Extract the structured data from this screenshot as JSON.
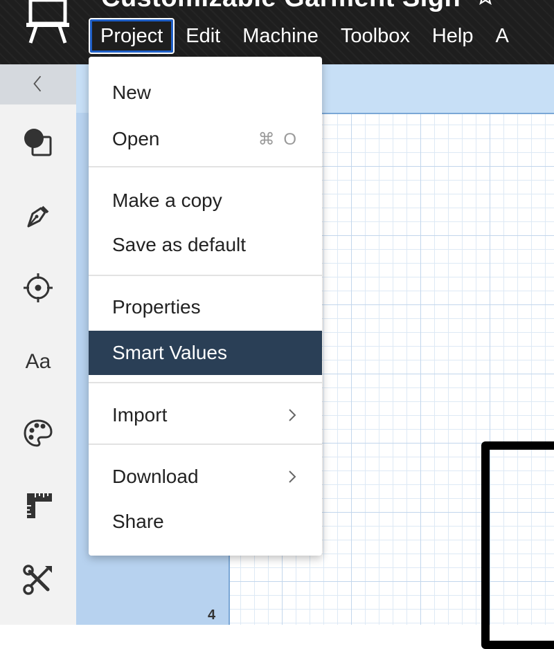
{
  "header": {
    "title": "Customizable Garment Sign",
    "menus": [
      {
        "label": "Project",
        "active": true
      },
      {
        "label": "Edit"
      },
      {
        "label": "Machine"
      },
      {
        "label": "Toolbox"
      },
      {
        "label": "Help"
      },
      {
        "label": "A"
      }
    ]
  },
  "sidebar": {
    "collapse_glyph": "<",
    "tools": [
      {
        "name": "shapes-icon"
      },
      {
        "name": "pen-icon"
      },
      {
        "name": "crosshair-icon"
      },
      {
        "name": "text-icon",
        "label": "Aa"
      },
      {
        "name": "palette-icon"
      },
      {
        "name": "ruler-icon"
      },
      {
        "name": "tools-icon"
      }
    ]
  },
  "dropdown": {
    "items": [
      {
        "label": "New",
        "shortcut": ""
      },
      {
        "label": "Open",
        "shortcut": "⌘ O"
      },
      {
        "label": "Make a copy"
      },
      {
        "label": "Save as default"
      },
      {
        "label": "Properties"
      },
      {
        "label": "Smart Values",
        "highlighted": true
      },
      {
        "label": "Import",
        "submenu": true
      },
      {
        "label": "Download",
        "submenu": true
      },
      {
        "label": "Share"
      }
    ]
  },
  "canvas": {
    "ruler_label": "4"
  },
  "colors": {
    "topbar": "#1e1e1e",
    "highlight": "#2a3f56",
    "canvas_bg": "#bcd6f0",
    "active_outline": "#1f5fc7"
  }
}
